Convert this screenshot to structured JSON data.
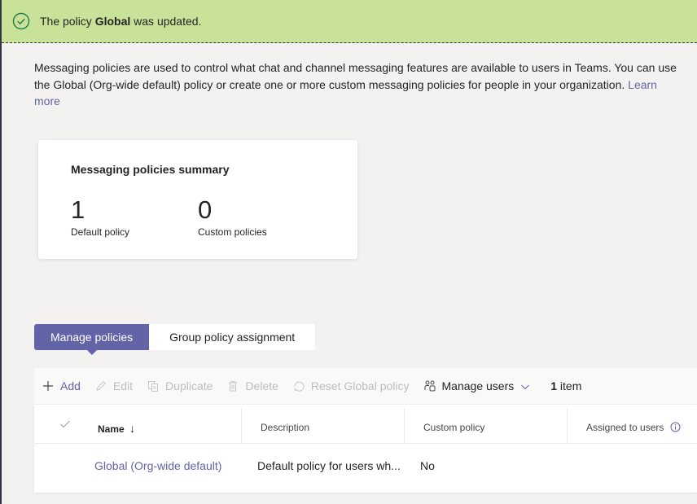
{
  "banner": {
    "icon": "check-circle-icon",
    "message_prefix": "The policy ",
    "message_bold": "Global",
    "message_suffix": " was updated.",
    "color": "#c8e29a"
  },
  "intro": {
    "text": "Messaging policies are used to control what chat and channel messaging features are available to users in Teams. You can use the Global (Org-wide default) policy or create one or more custom messaging policies for people in your organization.",
    "link_label": "Learn more"
  },
  "summary": {
    "title": "Messaging policies summary",
    "stats": [
      {
        "value": "1",
        "label": "Default policy"
      },
      {
        "value": "0",
        "label": "Custom policies"
      }
    ]
  },
  "tabs": [
    {
      "label": "Manage policies",
      "active": true
    },
    {
      "label": "Group policy assignment",
      "active": false
    }
  ],
  "toolbar": {
    "add": {
      "label": "Add",
      "icon": "plus-icon"
    },
    "edit": {
      "label": "Edit",
      "icon": "pencil-icon"
    },
    "duplicate": {
      "label": "Duplicate",
      "icon": "duplicate-icon"
    },
    "delete": {
      "label": "Delete",
      "icon": "trash-icon"
    },
    "reset": {
      "label": "Reset Global policy",
      "icon": "reset-icon"
    },
    "manage_users": {
      "label": "Manage users",
      "icon": "people-icon"
    },
    "count_number": "1",
    "count_label": " item"
  },
  "table": {
    "columns": [
      "Name",
      "Description",
      "Custom policy",
      "Assigned to users"
    ],
    "sort_indicator": "↓",
    "rows": [
      {
        "name": "Global (Org-wide default)",
        "description": "Default policy for users wh...",
        "custom_policy": "No",
        "assigned": ""
      }
    ]
  },
  "colors": {
    "accent": "#6264a7",
    "success_icon": "#237b4b"
  }
}
